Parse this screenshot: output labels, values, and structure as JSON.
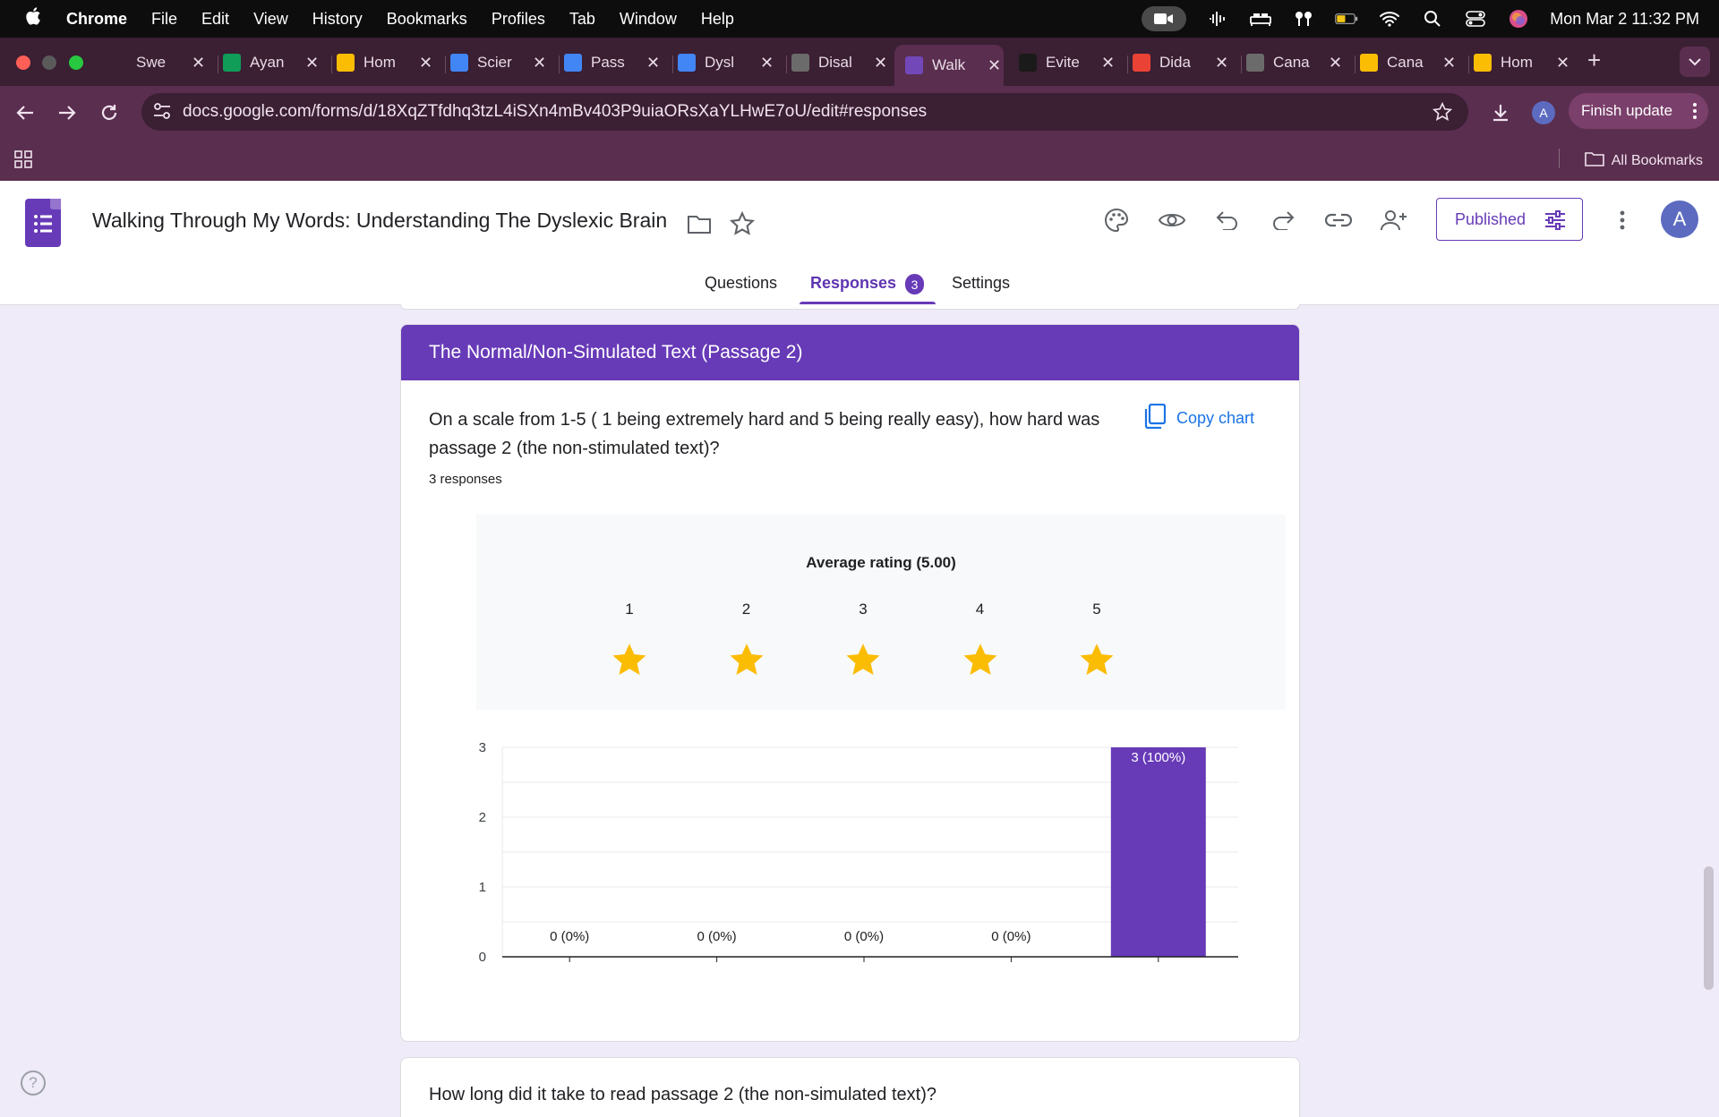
{
  "menubar": {
    "app_name": "Chrome",
    "items": [
      "File",
      "Edit",
      "View",
      "History",
      "Bookmarks",
      "Profiles",
      "Tab",
      "Window",
      "Help"
    ],
    "clock": "Mon Mar 2  11:32 PM"
  },
  "tabs": [
    {
      "label": "Swe",
      "icon": "openai-icon",
      "color": "#3b1f33"
    },
    {
      "label": "Ayan",
      "icon": "sheets-icon",
      "color": "#0f9d58"
    },
    {
      "label": "Hom",
      "icon": "drive-icon",
      "color": "#fbbc04"
    },
    {
      "label": "Scier",
      "icon": "docs-icon",
      "color": "#4285f4"
    },
    {
      "label": "Pass",
      "icon": "docs-icon",
      "color": "#4285f4"
    },
    {
      "label": "Dysl",
      "icon": "docs-icon",
      "color": "#4285f4"
    },
    {
      "label": "Disal",
      "icon": "globe-icon",
      "color": "#6b6b6b"
    },
    {
      "label": "Walk",
      "icon": "forms-icon",
      "color": "#7248b9",
      "active": true
    },
    {
      "label": "Evite",
      "icon": "evite-icon",
      "color": "#1a1a1a"
    },
    {
      "label": "Dida",
      "icon": "gmail-icon",
      "color": "#ea4335"
    },
    {
      "label": "Cana",
      "icon": "canva-icon",
      "color": "#6b6b6b"
    },
    {
      "label": "Cana",
      "icon": "drive-icon",
      "color": "#fbbc04"
    },
    {
      "label": "Hom",
      "icon": "drive-icon",
      "color": "#fbbc04"
    }
  ],
  "toolbar": {
    "url": "docs.google.com/forms/d/18XqZTfdhq3tzL4iSXn4mBv403P9uiaORsXaYLHwE7oU/edit#responses",
    "finish_update": "Finish update",
    "profile_initial": "A"
  },
  "bookmarks": {
    "all_bookmarks": "All Bookmarks"
  },
  "form_header": {
    "title": "Walking Through My Words: Understanding The Dyslexic Brain",
    "published_label": "Published",
    "avatar_initial": "A",
    "tabs": {
      "questions": "Questions",
      "responses": "Responses",
      "settings": "Settings"
    },
    "responses_badge": "3"
  },
  "section": {
    "title": "The Normal/Non-Simulated Text (Passage 2)",
    "question": "On a scale from 1-5 ( 1 being extremely hard and 5 being really easy), how hard was passage 2 (the non-stimulated text)?",
    "responses_count": "3 responses",
    "copy_chart": "Copy chart",
    "average_rating": "Average rating (5.00)",
    "star_numbers": [
      "1",
      "2",
      "3",
      "4",
      "5"
    ],
    "filled_stars": 5,
    "star_color": "#fbbc04"
  },
  "chart_data": {
    "type": "bar",
    "categories": [
      "1",
      "2",
      "3",
      "4",
      "5"
    ],
    "values": [
      0,
      0,
      0,
      0,
      3
    ],
    "labels": [
      "0 (0%)",
      "0 (0%)",
      "0 (0%)",
      "0 (0%)",
      "3 (100%)"
    ],
    "y_ticks": [
      "0",
      "1",
      "2",
      "3"
    ],
    "ylim": [
      0,
      3
    ],
    "bar_color": "#673ab7",
    "grid": true
  },
  "next_question": "How long did it take to read passage 2 (the non-simulated text)?"
}
